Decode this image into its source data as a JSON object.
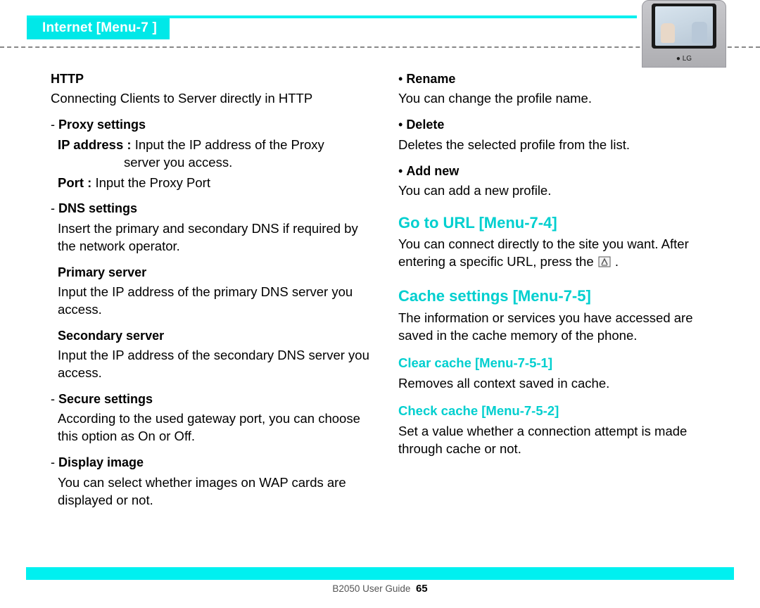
{
  "header": {
    "title": "Internet [Menu-7 ]"
  },
  "phone": {
    "brand": "LG"
  },
  "left": {
    "http_heading": "HTTP",
    "http_body": "Connecting Clients to Server directly in HTTP",
    "proxy_heading": "Proxy settings",
    "ip_label": "IP address :",
    "ip_body_l1": "Input the IP address of the Proxy",
    "ip_body_l2": "server you access.",
    "port_label": "Port :",
    "port_body": "Input the Proxy Port",
    "dns_heading": "DNS settings",
    "dns_body": "Insert the primary and secondary DNS if required by the network operator.",
    "primary_heading": "Primary server",
    "primary_body": "Input the IP address of the primary DNS server you access.",
    "secondary_heading": "Secondary server",
    "secondary_body": "Input the IP address of the secondary DNS server you access.",
    "secure_heading": "Secure settings",
    "secure_body": "According to the used gateway port, you can choose this option as On or Off.",
    "display_heading": "Display image",
    "display_body": "You can select whether images on WAP cards are displayed or not."
  },
  "right": {
    "rename_heading": "Rename",
    "rename_body": "You can change the profile name.",
    "delete_heading": "Delete",
    "delete_body": "Deletes the selected profile from the list.",
    "addnew_heading": "Add new",
    "addnew_body": "You can add a new profile.",
    "goto_heading": "Go to URL [Menu-7-4]",
    "goto_body_a": "You can connect directly to the site you want. After entering a specific URL, press the ",
    "goto_body_b": " .",
    "cache_heading": "Cache settings [Menu-7-5]",
    "cache_body": "The information or services you have accessed are saved in the cache memory of the phone.",
    "clear_heading": "Clear cache [Menu-7-5-1]",
    "clear_body": "Removes all context saved in cache.",
    "check_heading": "Check cache [Menu-7-5-2]",
    "check_body": "Set a value whether a connection attempt is made through cache or not."
  },
  "footer": {
    "guide": "B2050 User Guide",
    "page": "65"
  }
}
